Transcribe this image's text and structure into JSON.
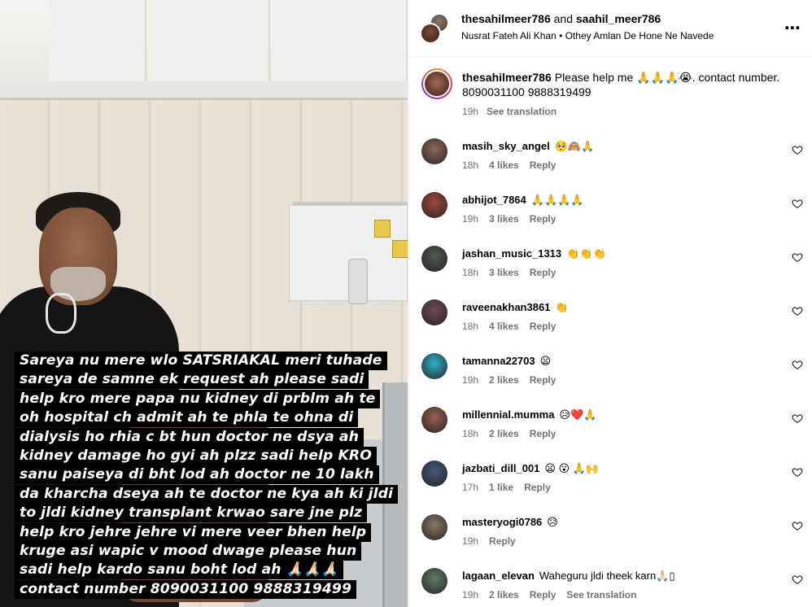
{
  "post": {
    "users_primary": "thesahilmeer786",
    "users_and": " and ",
    "users_secondary": "saahil_meer786",
    "audio": "Nusrat Fateh Ali Khan • Othey Amlan De Hone Ne Navede",
    "more_icon": "more-options-icon"
  },
  "media": {
    "caption_lines": [
      "Sareya nu mere wlo SATSRIAKAL meri tuhade",
      "sareya de samne ek request ah please sadi",
      "help kro mere papa nu kidney di prblm ah te",
      "oh hospital ch admit ah te phla te ohna di",
      "dialysis ho rhia c bt hun doctor ne dsya ah",
      "kidney damage ho gyi ah plzz sadi help KRO",
      "sanu paiseya di bht lod ah doctor ne 10 lakh",
      "da kharcha dseya ah te doctor ne kya ah ki jldi",
      "to jldi kidney transplant krwao sare jne plz",
      "help kro jehre jehre vi mere veer bhen help",
      "kruge asi wapic v mood dwage please hun",
      "sadi help kardo sanu boht lod ah  🙏🏻🙏🏻🙏🏻",
      "contact number 8090031100 9888319499"
    ]
  },
  "caption_post": {
    "username": "thesahilmeer786",
    "text": "Please help me 🙏🙏🙏😭. contact number. 8090031100 9888319499",
    "time": "19h",
    "see_translation": "See translation"
  },
  "comments": [
    {
      "username": "masih_sky_angel",
      "text": "🥺🙈🙏",
      "time": "18h",
      "likes": "4 likes",
      "reply": "Reply",
      "avatar_color": "#8b6a5a"
    },
    {
      "username": "abhijot_7864",
      "text": "🙏🙏🙏🙏",
      "time": "19h",
      "likes": "3 likes",
      "reply": "Reply",
      "avatar_color": "#a0493c"
    },
    {
      "username": "jashan_music_1313",
      "text": "👏👏👏",
      "time": "18h",
      "likes": "3 likes",
      "reply": "Reply",
      "avatar_color": "#4e5a52"
    },
    {
      "username": "raveenakhan3861",
      "text": "👏",
      "time": "18h",
      "likes": "4 likes",
      "reply": "Reply",
      "avatar_color": "#6d4a55"
    },
    {
      "username": "tamanna22703",
      "text": "😦",
      "time": "19h",
      "likes": "2 likes",
      "reply": "Reply",
      "avatar_color": "#2bb3c9"
    },
    {
      "username": "millennial.mumma",
      "text": "😥❤️🙏",
      "time": "18h",
      "likes": "2 likes",
      "reply": "Reply",
      "avatar_color": "#9a5f4f"
    },
    {
      "username": "jazbati_dill_001",
      "text": "😦 😮 🙏🙌",
      "time": "17h",
      "likes": "1 like",
      "reply": "Reply",
      "avatar_color": "#3f5a78"
    },
    {
      "username": "masteryogi0786",
      "text": "😥",
      "time": "19h",
      "likes": "",
      "reply": "Reply",
      "avatar_color": "#8a7a66"
    },
    {
      "username": "lagaan_elevan",
      "text": "Waheguru jldi theek karn🙏🏻▯",
      "time": "19h",
      "likes": "2 likes",
      "reply": "Reply",
      "see_translation": "See translation",
      "avatar_color": "#5f7d6a"
    }
  ]
}
